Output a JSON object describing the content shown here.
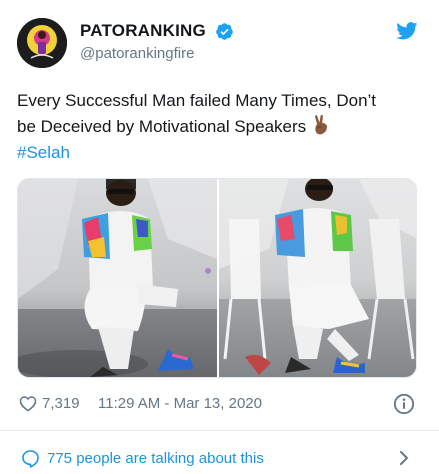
{
  "tweet": {
    "author": {
      "name": "PATORANKING",
      "handle": "@patorankingfire",
      "avatar_icon": "avatar-image",
      "verified_icon": "verified-badge-icon"
    },
    "text": {
      "line1": "Every Successful Man failed Many Times, Don’t",
      "line2": "be Deceived by Motivational Speakers",
      "emoji": "victory-hand-emoji",
      "hashtag": "#Selah"
    },
    "media": {
      "photos": [
        {
          "description_icon": "photo-man-seated-in-white-outfit"
        },
        {
          "description_icon": "photo-man-seated-on-plastic-chair"
        }
      ]
    },
    "stats": {
      "likes": "7,319",
      "timestamp": "11:29 AM - Mar 13, 2020"
    },
    "conversation": {
      "label": "775 people are talking about this"
    },
    "colors": {
      "accent": "#1b95e0",
      "secondary_text": "#657786",
      "primary_text": "#14171a",
      "border": "#e1e8ed"
    }
  }
}
